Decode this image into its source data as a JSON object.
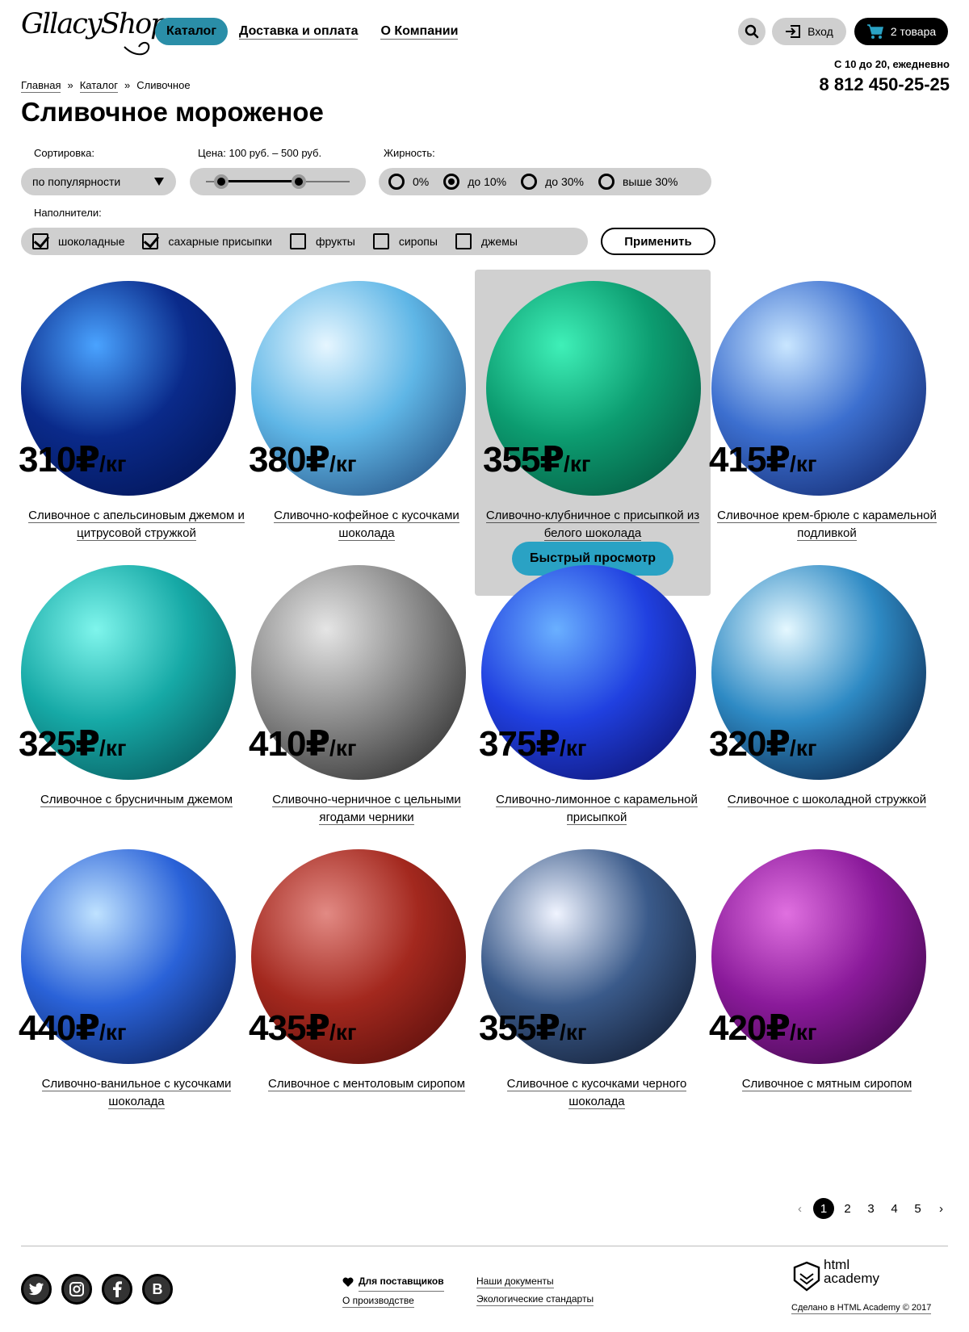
{
  "header": {
    "logo": "GllacyShop",
    "nav": [
      {
        "label": "Каталог",
        "active": true
      },
      {
        "label": "Доставка и оплата",
        "active": false
      },
      {
        "label": "О Компании",
        "active": false
      }
    ],
    "login_label": "Вход",
    "cart_label": "2 товара",
    "hours": "С 10 до 20, ежедневно",
    "phone": "8 812 450-25-25"
  },
  "breadcrumb": [
    "Главная",
    "»",
    "Каталог",
    "»",
    "Сливочное"
  ],
  "page_title": "Сливочное мороженое",
  "filters": {
    "sort_label": "Сортировка:",
    "sort_value": "по популярности",
    "price_label": "Цена: 100 руб. – 500 руб.",
    "price_range": [
      100,
      500
    ],
    "fat_label": "Жирность:",
    "fat_options": [
      {
        "label": "0%",
        "checked": false
      },
      {
        "label": "до 10%",
        "checked": true
      },
      {
        "label": "до 30%",
        "checked": false
      },
      {
        "label": "выше 30%",
        "checked": false
      }
    ],
    "fillers_label": "Наполнители:",
    "fillers": [
      {
        "label": "шоколадные",
        "checked": true
      },
      {
        "label": "сахарные присыпки",
        "checked": true
      },
      {
        "label": "фрукты",
        "checked": false
      },
      {
        "label": "сиропы",
        "checked": false
      },
      {
        "label": "джемы",
        "checked": false
      }
    ],
    "apply_label": "Применить"
  },
  "currency": "₽",
  "unit": "/кг",
  "products": [
    {
      "price": "310",
      "name": "Сливочное с апельсиновым джемом и цитрусовой стружкой",
      "c1": "#4aa3ff",
      "c2": "#0a2a8a",
      "c3": "#01104a"
    },
    {
      "price": "380",
      "name": "Сливочно-кофейное с кусочками шоколада",
      "c1": "#e6f6ff",
      "c2": "#5fb6e6",
      "c3": "#1a3c70"
    },
    {
      "price": "355",
      "name": "Сливочно-клубничное с присыпкой из белого шоколада",
      "c1": "#3ff0b8",
      "c2": "#0c9c70",
      "c3": "#034a36"
    },
    {
      "price": "415",
      "name": "Сливочное крем-брюле с карамельной подливкой",
      "c1": "#c9e6ff",
      "c2": "#3c6fcf",
      "c3": "#0a1a5a"
    },
    {
      "price": "325",
      "name": "Сливочное с брусничным джемом",
      "c1": "#7ff5ec",
      "c2": "#16a9a6",
      "c3": "#04454a"
    },
    {
      "price": "410",
      "name": "Сливочно-черничное с цельными ягодами черники",
      "c1": "#e5e5e5",
      "c2": "#8a8a8a",
      "c3": "#1a1a1a"
    },
    {
      "price": "375",
      "name": "Сливочно-лимонное с карамельной присыпкой",
      "c1": "#6ab0ff",
      "c2": "#2040e0",
      "c3": "#0a0a5a"
    },
    {
      "price": "320",
      "name": "Сливочное с шоколадной стружкой",
      "c1": "#e5f8ff",
      "c2": "#2e8ac4",
      "c3": "#030a2a"
    },
    {
      "price": "440",
      "name": "Сливочно-ванильное с кусочками шоколада",
      "c1": "#bfe2ff",
      "c2": "#2a62d8",
      "c3": "#061440"
    },
    {
      "price": "435",
      "name": "Сливочное с ментоловым сиропом",
      "c1": "#e28a84",
      "c2": "#a3281e",
      "c3": "#4a0a08"
    },
    {
      "price": "355",
      "name": "Сливочное с кусочками черного шоколада",
      "c1": "#f0f4ff",
      "c2": "#3a5a8a",
      "c3": "#0a1020"
    },
    {
      "price": "420",
      "name": "Сливочное с мятным сиропом",
      "c1": "#e070e0",
      "c2": "#8a1a9a",
      "c3": "#2e0436"
    }
  ],
  "quick_view_label": "Быстрый просмотр",
  "pagination": {
    "prev": "‹",
    "pages": [
      "1",
      "2",
      "3",
      "4",
      "5"
    ],
    "current": "1",
    "next": "›"
  },
  "footer": {
    "socials": [
      "twitter-icon",
      "instagram-icon",
      "facebook-icon",
      "vk-icon"
    ],
    "vk_letter": "B",
    "links_col1": [
      "Для поставщиков",
      "О производстве"
    ],
    "links_col2": [
      "Наши документы",
      "Экологические стандарты"
    ],
    "academy_line1": "html",
    "academy_line2": "academy",
    "made_by": "Сделано в HTML Academy © 2017"
  }
}
